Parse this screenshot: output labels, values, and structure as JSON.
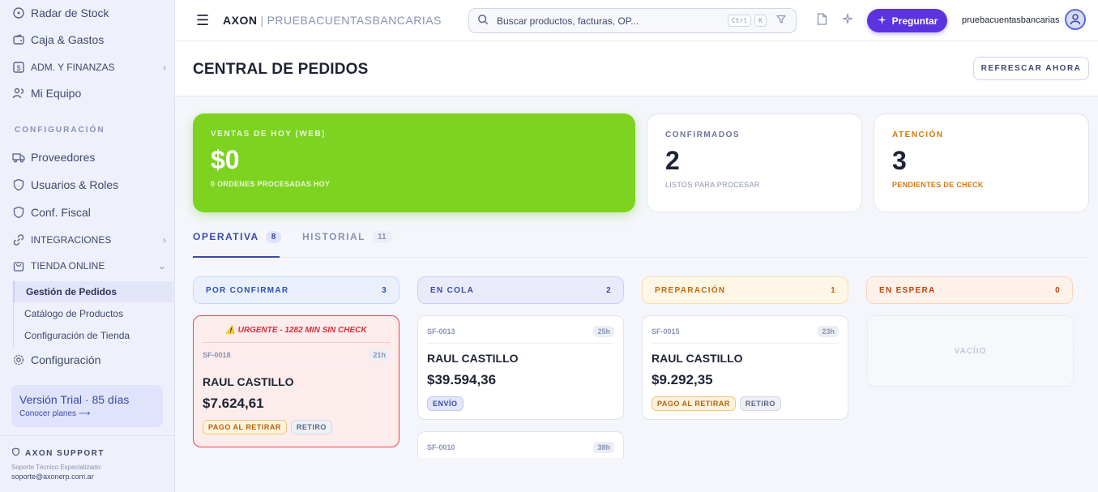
{
  "sidebar": {
    "top_items": [
      {
        "label": "Radar de Stock"
      },
      {
        "label": "Caja & Gastos"
      },
      {
        "label": "ADM. Y FINANZAS"
      },
      {
        "label": "Mi Equipo"
      }
    ],
    "section_label": "CONFIGURACIÓN",
    "config_items": [
      {
        "label": "Proveedores"
      },
      {
        "label": "Usuarios & Roles"
      },
      {
        "label": "Conf. Fiscal"
      },
      {
        "label": "INTEGRACIONES"
      },
      {
        "label": "TIENDA ONLINE"
      }
    ],
    "sub_items": [
      {
        "label": "Gestión de Pedidos"
      },
      {
        "label": "Catálogo de Productos"
      },
      {
        "label": "Configuración de Tienda"
      }
    ],
    "settings_label": "Configuración",
    "trial": {
      "title": "Versión Trial · 85 días",
      "link": "Conocer planes ⟶"
    },
    "support": {
      "title": "AXON SUPPORT",
      "subtitle": "Soporte Técnico Especializado:",
      "email": "soporte@axonerp.com.ar"
    }
  },
  "header": {
    "brand": "AXON",
    "separator": "|",
    "company": "PRUEBACUENTASBANCARIAS",
    "search_placeholder": "Buscar productos, facturas, OP...",
    "kbd_ctrl": "Ctrl",
    "kbd_k": "K",
    "ask_label": "Preguntar",
    "username": "pruebacuentasbancarias"
  },
  "page": {
    "title": "CENTRAL DE PEDIDOS",
    "refresh_label": "REFRESCAR AHORA"
  },
  "stats": {
    "sales": {
      "label": "VENTAS DE HOY (WEB)",
      "value": "$0",
      "sub": "0 ORDENES PROCESADAS HOY"
    },
    "confirmed": {
      "label": "CONFIRMADOS",
      "value": "2",
      "sub": "LISTOS PARA PROCESAR"
    },
    "attention": {
      "label": "ATENCIÓN",
      "value": "3",
      "sub": "PENDIENTES DE CHECK"
    }
  },
  "tabs": [
    {
      "label": "OPERATIVA",
      "count": "8"
    },
    {
      "label": "HISTORIAL",
      "count": "11"
    }
  ],
  "columns": [
    {
      "title": "POR CONFIRMAR",
      "count": "3",
      "color": "#2b4fb8",
      "bg": "#eaf1fd",
      "border": "#c9d8f6"
    },
    {
      "title": "EN COLA",
      "count": "2",
      "color": "#3a4aa6",
      "bg": "#e9ebfb",
      "border": "#cbd0f2"
    },
    {
      "title": "PREPARACIÓN",
      "count": "1",
      "color": "#c2680d",
      "bg": "#fef7e6",
      "border": "#f6dfae"
    },
    {
      "title": "EN ESPERA",
      "count": "0",
      "color": "#c2410c",
      "bg": "#fef1ea",
      "border": "#f7d4c1"
    }
  ],
  "orders": {
    "urgent": {
      "alert": "URGENTE - 1282 MIN SIN CHECK",
      "code": "SF-0018",
      "ago": "21h",
      "name": "RAUL CASTILLO",
      "amount": "$7.624,61",
      "badge1": "PAGO AL RETIRAR",
      "badge2": "RETIRO"
    },
    "q1": {
      "code": "SF-0013",
      "ago": "25h",
      "name": "RAUL CASTILLO",
      "amount": "$39.594,36",
      "badge1": "ENVÍO"
    },
    "q2": {
      "code": "SF-0010",
      "ago": "38h"
    },
    "p1": {
      "code": "SF-0015",
      "ago": "23h",
      "name": "RAUL CASTILLO",
      "amount": "$9.292,35",
      "badge1": "PAGO AL RETIRAR",
      "badge2": "RETIRO"
    }
  },
  "empty_label": "VACÍIO"
}
